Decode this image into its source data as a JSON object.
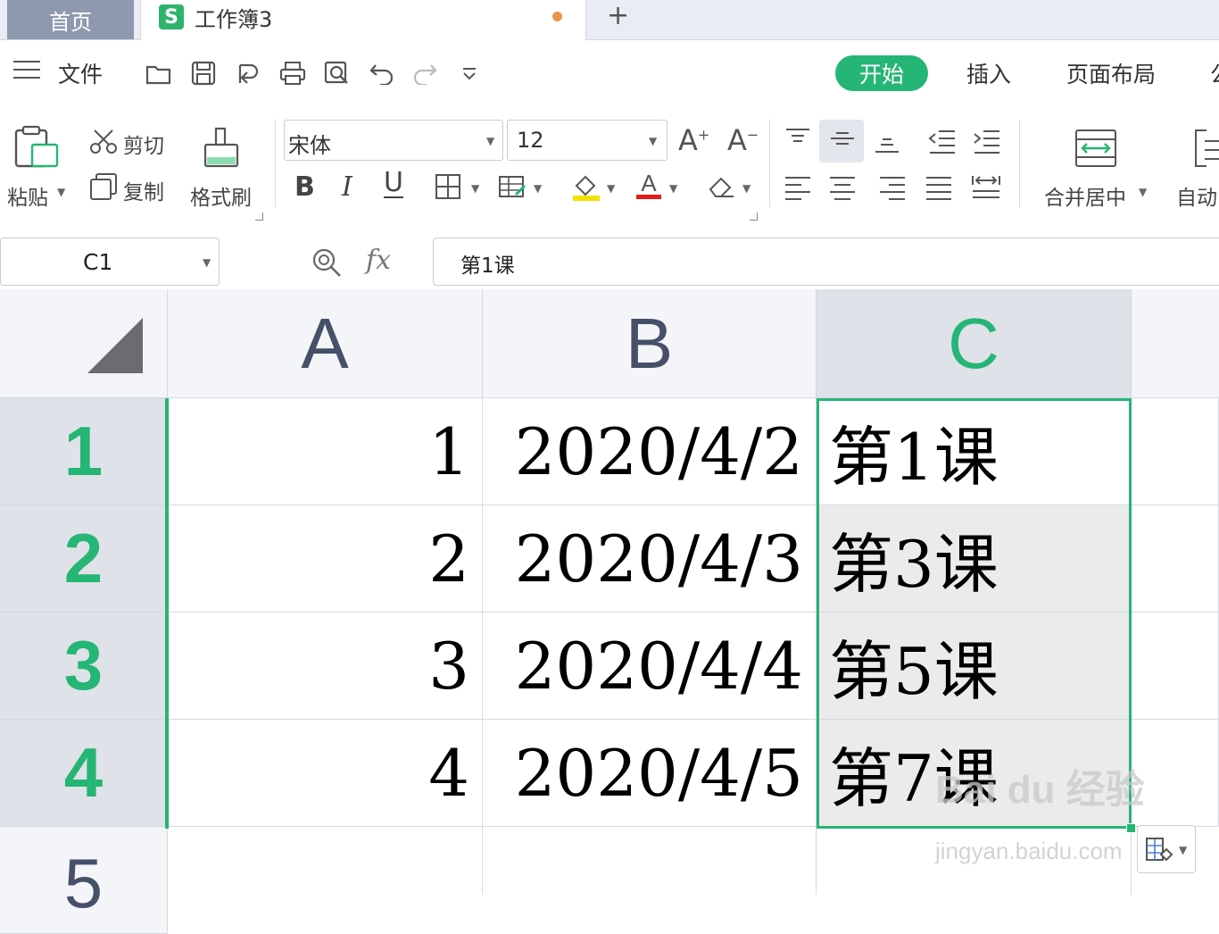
{
  "tabs": {
    "home": "首页",
    "doc_logo": "S",
    "doc_title": "工作簿3",
    "add": "+"
  },
  "menu": {
    "file": "文件",
    "tabs": [
      "开始",
      "插入",
      "页面布局",
      "公"
    ]
  },
  "ribbon": {
    "paste": "粘贴",
    "cut": "剪切",
    "copy": "复制",
    "format_painter": "格式刷",
    "font_name": "宋体",
    "font_size": "12",
    "bold": "B",
    "italic": "I",
    "underline": "U",
    "merge_center": "合并居中",
    "auto_wrap": "自动"
  },
  "formula_bar": {
    "cell_ref": "C1",
    "fx": "fx",
    "content": "第1课"
  },
  "sheet": {
    "columns": [
      "A",
      "B",
      "C"
    ],
    "rows": [
      "1",
      "2",
      "3",
      "4",
      "5"
    ],
    "cells": [
      [
        "1",
        "2020/4/2",
        "第1课"
      ],
      [
        "2",
        "2020/4/3",
        "第3课"
      ],
      [
        "3",
        "2020/4/4",
        "第5课"
      ],
      [
        "4",
        "2020/4/5",
        "第7课"
      ]
    ]
  },
  "watermark": {
    "main": "Bai du 经验",
    "sub": "jingyan.baidu.com"
  },
  "colors": {
    "accent": "#25b575",
    "tab_home": "#8e99b0",
    "dot": "#e8944a"
  }
}
